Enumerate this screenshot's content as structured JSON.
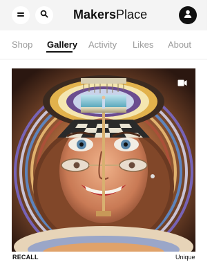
{
  "header": {
    "logo_bold": "Makers",
    "logo_light": "Place",
    "menu_icon": "menu-icon",
    "search_icon": "search-icon",
    "account_icon": "account-icon"
  },
  "tabs": [
    {
      "label": "Shop",
      "active": false
    },
    {
      "label": "Gallery",
      "active": true
    },
    {
      "label": "Activity",
      "active": false
    },
    {
      "label": "Likes",
      "active": false
    },
    {
      "label": "About",
      "active": false
    }
  ],
  "artwork": {
    "media_icon": "video-icon",
    "title": "RECALL",
    "edition": "Unique"
  },
  "colors": {
    "header_bg": "#f4f4f4",
    "text_primary": "#111111",
    "tab_inactive": "#9b9b9b"
  }
}
